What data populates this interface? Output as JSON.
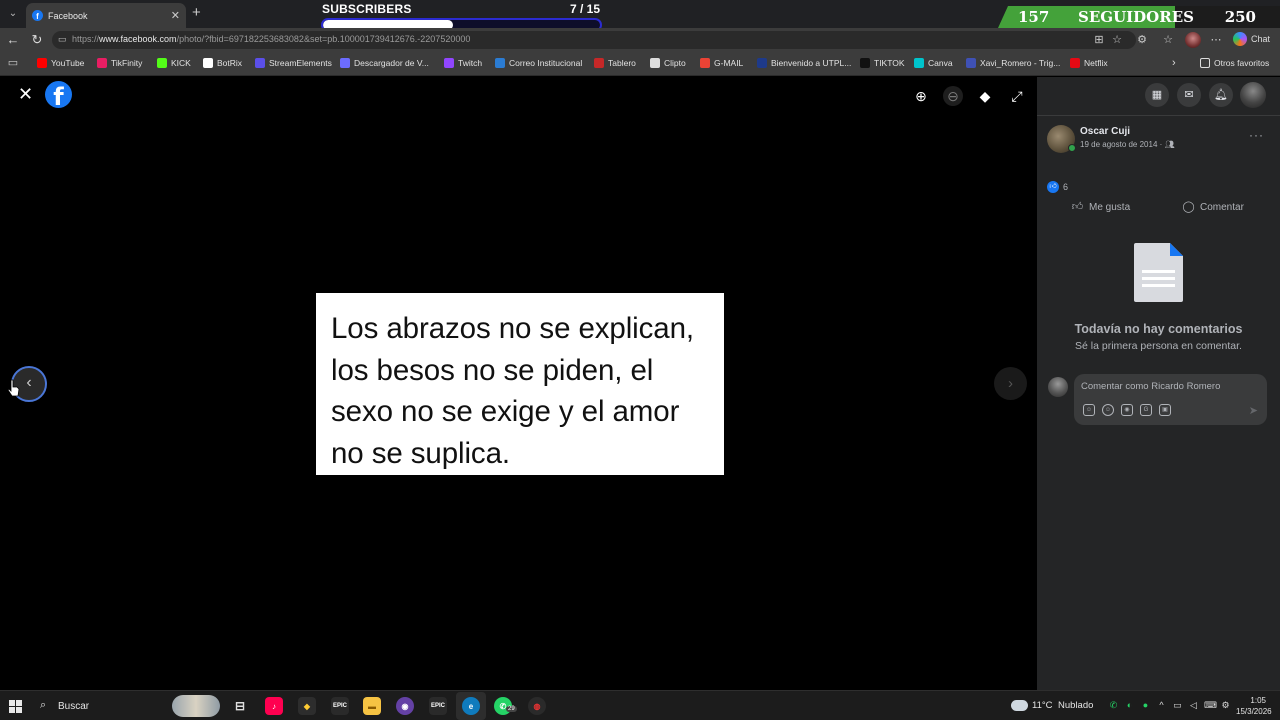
{
  "browser": {
    "tab_title": "Facebook",
    "url_prefix": "https://",
    "url_host": "www.facebook.com",
    "url_path": "/photo/?fbid=697182253683082&set=pb.100001739412676.-2207520000",
    "copilot_label": "Chat"
  },
  "overlay": {
    "subscribers_label": "SUBSCRIBERS",
    "subscribers_count": "7  / 15",
    "subscribers_progress": 0.47,
    "followers_current": "157",
    "followers_label": "SEGUIDORES",
    "followers_goal": "250",
    "followers_progress": 0.628
  },
  "bookmarks": [
    {
      "label": "YouTube",
      "icon": "youtube-icon",
      "color": "#ff0000"
    },
    {
      "label": "TikFinity",
      "icon": "tikfinity-icon",
      "color": "#e91e63"
    },
    {
      "label": "KICK",
      "icon": "kick-icon",
      "color": "#53fc18"
    },
    {
      "label": "BotRix",
      "icon": "botrix-icon",
      "color": "#ffffff"
    },
    {
      "label": "StreamElements",
      "icon": "streamelements-icon",
      "color": "#5b4fe9"
    },
    {
      "label": "Descargador de V...",
      "icon": "downloader-icon",
      "color": "#6c6cff"
    },
    {
      "label": "Twitch",
      "icon": "twitch-icon",
      "color": "#9146ff"
    },
    {
      "label": "Correo Institucional",
      "icon": "mail-icon",
      "color": "#2b7cd3"
    },
    {
      "label": "Tablero",
      "icon": "tablero-icon",
      "color": "#c62828"
    },
    {
      "label": "Clipto",
      "icon": "clipto-icon",
      "color": "#dddddd"
    },
    {
      "label": "G-MAIL",
      "icon": "gmail-icon",
      "color": "#ea4335"
    },
    {
      "label": "Bienvenido a UTPL...",
      "icon": "utpl-icon",
      "color": "#1e3a8a"
    },
    {
      "label": "TIKTOK",
      "icon": "tiktok-icon",
      "color": "#111111"
    },
    {
      "label": "Canva",
      "icon": "canva-icon",
      "color": "#00c4cc"
    },
    {
      "label": "Xavi_Romero - Trig...",
      "icon": "trigger-icon",
      "color": "#3f51b5"
    },
    {
      "label": "Netflix",
      "icon": "netflix-icon",
      "color": "#e50914"
    }
  ],
  "bookmarks_other": "Otros favoritos",
  "photo": {
    "text": "Los abrazos no se explican, los besos no se piden, el sexo no se exige y el amor no se suplica."
  },
  "post": {
    "author": "Oscar Cuji",
    "date": "19 de agosto de 2014 · ",
    "like_count": "6",
    "like_label": "Me gusta",
    "comment_label": "Comentar",
    "empty_title": "Todavía no hay comentarios",
    "empty_subtitle": "Sé la primera persona en comentar.",
    "comment_placeholder": "Comentar como Ricardo Romero"
  },
  "taskbar": {
    "search_label": "Buscar",
    "whatsapp_badge": "29",
    "temperature": "11°C",
    "weather": "Nublado",
    "time": "1:05",
    "date": "15/3/2026"
  },
  "colors": {
    "facebook_blue": "#1877f2",
    "panel_bg": "#242526",
    "followers_green": "#44a23a",
    "subscribers_border": "#2b2bd0"
  }
}
